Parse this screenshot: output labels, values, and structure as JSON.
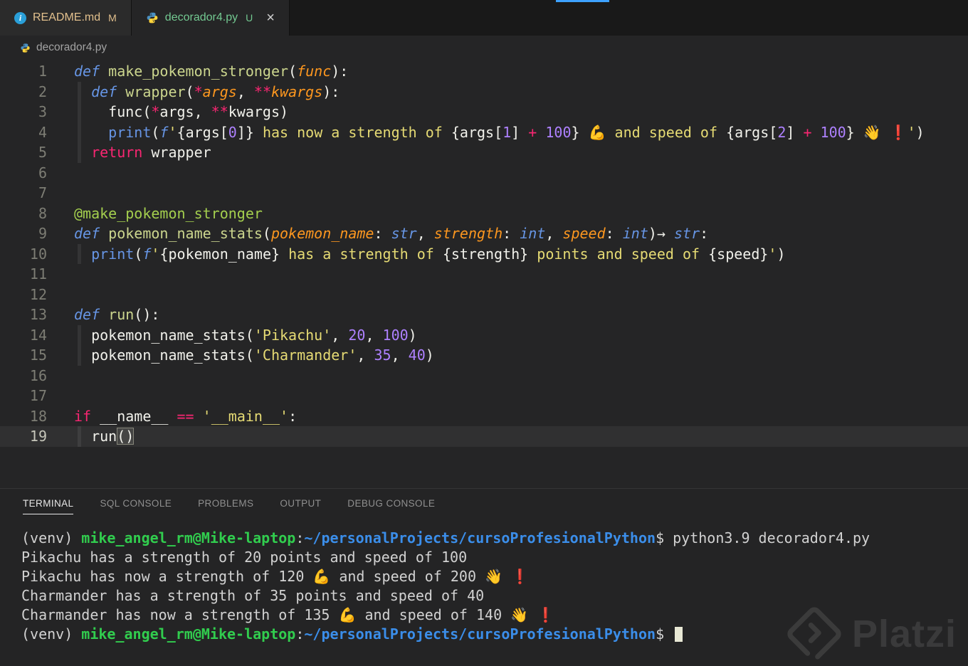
{
  "tabs": [
    {
      "label": "README.md",
      "badge": "M",
      "icon": "info-icon",
      "icon_glyph": "i",
      "state": "inactive",
      "git_status": "modified"
    },
    {
      "label": "decorador4.py",
      "badge": "U",
      "icon": "python-icon",
      "state": "active",
      "git_status": "untracked",
      "close_glyph": "×"
    }
  ],
  "breadcrumb": {
    "file": "decorador4.py"
  },
  "editor": {
    "language": "python",
    "active_line": 19,
    "indent_guides": [
      {
        "from": 2,
        "to": 5
      },
      {
        "from": 10,
        "to": 10
      },
      {
        "from": 14,
        "to": 15
      },
      {
        "from": 19,
        "to": 19
      }
    ],
    "lines": [
      {
        "n": 1,
        "tokens": [
          [
            "st",
            "def "
          ],
          [
            "fn",
            "make_pokemon_stronger"
          ],
          [
            "pl",
            "("
          ],
          [
            "pa",
            "func"
          ],
          [
            "pl",
            "):"
          ]
        ]
      },
      {
        "n": 2,
        "tokens": [
          [
            "pl",
            "  "
          ],
          [
            "st",
            "def "
          ],
          [
            "fn",
            "wrapper"
          ],
          [
            "pl",
            "("
          ],
          [
            "op",
            "*"
          ],
          [
            "pa",
            "args"
          ],
          [
            "pl",
            ", "
          ],
          [
            "op",
            "**"
          ],
          [
            "pa",
            "kwargs"
          ],
          [
            "pl",
            "):"
          ]
        ]
      },
      {
        "n": 3,
        "tokens": [
          [
            "pl",
            "    func("
          ],
          [
            "op",
            "*"
          ],
          [
            "pl",
            "args, "
          ],
          [
            "op",
            "**"
          ],
          [
            "pl",
            "kwargs)"
          ]
        ]
      },
      {
        "n": 4,
        "tokens": [
          [
            "pl",
            "    "
          ],
          [
            "bi",
            "print"
          ],
          [
            "pl",
            "("
          ],
          [
            "stp",
            "f"
          ],
          [
            "str",
            "'"
          ],
          [
            "pl",
            "{args["
          ],
          [
            "num",
            "0"
          ],
          [
            "pl",
            "]}"
          ],
          [
            "str",
            " has now a strength of "
          ],
          [
            "pl",
            "{args["
          ],
          [
            "num",
            "1"
          ],
          [
            "pl",
            "] "
          ],
          [
            "op",
            "+"
          ],
          [
            "pl",
            " "
          ],
          [
            "num",
            "100"
          ],
          [
            "pl",
            "}"
          ],
          [
            "str",
            " "
          ],
          [
            "em",
            "💪"
          ],
          [
            "str",
            " and speed of "
          ],
          [
            "pl",
            "{args["
          ],
          [
            "num",
            "2"
          ],
          [
            "pl",
            "] "
          ],
          [
            "op",
            "+"
          ],
          [
            "pl",
            " "
          ],
          [
            "num",
            "100"
          ],
          [
            "pl",
            "}"
          ],
          [
            "str",
            " "
          ],
          [
            "em",
            "👋"
          ],
          [
            "str",
            " "
          ],
          [
            "emr",
            "❗"
          ],
          [
            "str",
            "'"
          ],
          [
            "pl",
            ")"
          ]
        ]
      },
      {
        "n": 5,
        "tokens": [
          [
            "pl",
            "  "
          ],
          [
            "kw",
            "return"
          ],
          [
            "pl",
            " wrapper"
          ]
        ]
      },
      {
        "n": 6,
        "tokens": []
      },
      {
        "n": 7,
        "tokens": []
      },
      {
        "n": 8,
        "tokens": [
          [
            "dec",
            "@make_pokemon_stronger"
          ]
        ]
      },
      {
        "n": 9,
        "tokens": [
          [
            "st",
            "def "
          ],
          [
            "fn",
            "pokemon_name_stats"
          ],
          [
            "pl",
            "("
          ],
          [
            "pa",
            "pokemon_name"
          ],
          [
            "pl",
            ": "
          ],
          [
            "ty",
            "str"
          ],
          [
            "pl",
            ", "
          ],
          [
            "pa",
            "strength"
          ],
          [
            "pl",
            ": "
          ],
          [
            "ty",
            "int"
          ],
          [
            "pl",
            ", "
          ],
          [
            "pa",
            "speed"
          ],
          [
            "pl",
            ": "
          ],
          [
            "ty",
            "int"
          ],
          [
            "pl",
            ")→ "
          ],
          [
            "ty",
            "str"
          ],
          [
            "pl",
            ":"
          ]
        ]
      },
      {
        "n": 10,
        "tokens": [
          [
            "pl",
            "  "
          ],
          [
            "bi",
            "print"
          ],
          [
            "pl",
            "("
          ],
          [
            "stp",
            "f"
          ],
          [
            "str",
            "'"
          ],
          [
            "pl",
            "{pokemon_name}"
          ],
          [
            "str",
            " has a strength of "
          ],
          [
            "pl",
            "{strength}"
          ],
          [
            "str",
            " points and speed of "
          ],
          [
            "pl",
            "{speed}"
          ],
          [
            "str",
            "'"
          ],
          [
            "pl",
            ")"
          ]
        ]
      },
      {
        "n": 11,
        "tokens": []
      },
      {
        "n": 12,
        "tokens": []
      },
      {
        "n": 13,
        "tokens": [
          [
            "st",
            "def "
          ],
          [
            "fn",
            "run"
          ],
          [
            "pl",
            "():"
          ]
        ]
      },
      {
        "n": 14,
        "tokens": [
          [
            "pl",
            "  pokemon_name_stats("
          ],
          [
            "str",
            "'Pikachu'"
          ],
          [
            "pl",
            ", "
          ],
          [
            "num",
            "20"
          ],
          [
            "pl",
            ", "
          ],
          [
            "num",
            "100"
          ],
          [
            "pl",
            ")"
          ]
        ]
      },
      {
        "n": 15,
        "tokens": [
          [
            "pl",
            "  pokemon_name_stats("
          ],
          [
            "str",
            "'Charmander'"
          ],
          [
            "pl",
            ", "
          ],
          [
            "num",
            "35"
          ],
          [
            "pl",
            ", "
          ],
          [
            "num",
            "40"
          ],
          [
            "pl",
            ")"
          ]
        ]
      },
      {
        "n": 16,
        "tokens": []
      },
      {
        "n": 17,
        "tokens": []
      },
      {
        "n": 18,
        "tokens": [
          [
            "kw",
            "if"
          ],
          [
            "pl",
            " __name__ "
          ],
          [
            "op",
            "=="
          ],
          [
            "pl",
            " "
          ],
          [
            "str",
            "'__main__'"
          ],
          [
            "pl",
            ":"
          ]
        ]
      },
      {
        "n": 19,
        "tokens": [
          [
            "pl",
            "  run"
          ],
          [
            "bh",
            "()"
          ]
        ]
      }
    ]
  },
  "panel": {
    "tabs": [
      "TERMINAL",
      "SQL CONSOLE",
      "PROBLEMS",
      "OUTPUT",
      "DEBUG CONSOLE"
    ],
    "active_tab": "TERMINAL",
    "terminal": {
      "lines": [
        {
          "segments": [
            [
              "pl",
              "(venv) "
            ],
            [
              "user",
              "mike_angel_rm@Mike-laptop"
            ],
            [
              "pl",
              ":"
            ],
            [
              "path",
              "~/personalProjects/cursoProfesionalPython"
            ],
            [
              "pl",
              "$ python3.9 decorador4.py"
            ]
          ]
        },
        {
          "segments": [
            [
              "pl",
              "Pikachu has a strength of 20 points and speed of 100"
            ]
          ]
        },
        {
          "segments": [
            [
              "pl",
              "Pikachu has now a strength of 120 "
            ],
            [
              "em",
              "💪"
            ],
            [
              "pl",
              " and speed of 200 "
            ],
            [
              "em",
              "👋"
            ],
            [
              "pl",
              " "
            ],
            [
              "emr",
              "❗"
            ]
          ]
        },
        {
          "segments": [
            [
              "pl",
              "Charmander has a strength of 35 points and speed of 40"
            ]
          ]
        },
        {
          "segments": [
            [
              "pl",
              "Charmander has now a strength of 135 "
            ],
            [
              "em",
              "💪"
            ],
            [
              "pl",
              " and speed of 140 "
            ],
            [
              "em",
              "👋"
            ],
            [
              "pl",
              " "
            ],
            [
              "emr",
              "❗"
            ]
          ]
        },
        {
          "segments": [
            [
              "pl",
              "(venv) "
            ],
            [
              "user",
              "mike_angel_rm@Mike-laptop"
            ],
            [
              "pl",
              ":"
            ],
            [
              "path",
              "~/personalProjects/cursoProfesionalPython"
            ],
            [
              "pl",
              "$ "
            ],
            [
              "cursor",
              ""
            ]
          ]
        }
      ]
    }
  },
  "watermark": {
    "text": "Platzi"
  },
  "colors": {
    "git_modified": "#e2c08d",
    "git_untracked": "#73c991",
    "terminal_green": "#31cd4e",
    "terminal_blue": "#3b8eea",
    "keyword_pink": "#f92672",
    "keyword_blue": "#6796e6",
    "string_yellow": "#e6db74",
    "number_purple": "#ae81ff",
    "param_orange": "#fd971f"
  }
}
